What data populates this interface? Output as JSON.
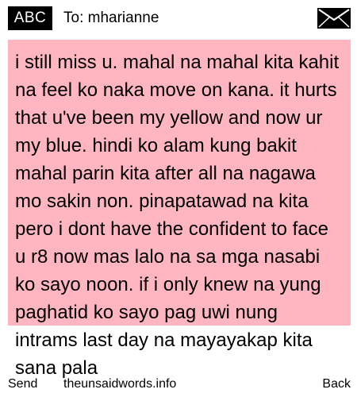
{
  "header": {
    "input_mode": "ABC",
    "recipient_label": "To: mharianne",
    "icon": "envelope-icon"
  },
  "message": {
    "text": "i still miss u. mahal na mahal kita kahit na feel ko naka move on kana. it hurts that u've been my yellow and now ur my blue. hindi ko alam kung bakit mahal parin kita after all na nagawa mo sakin non. pinapatawad na kita pero i dont have the confident to face u r8 now mas lalo na sa mga nasabi ko sayo noon. if i only knew na yung paghatid ko sayo pag uwi nung intrams last day na mayayakap kita sana pala"
  },
  "softkeys": {
    "left": "Send",
    "center": "theunsaidwords.info",
    "right": "Back"
  },
  "colors": {
    "highlight": "#ffb6c1",
    "badge_bg": "#000000",
    "badge_text": "#ffffff"
  }
}
